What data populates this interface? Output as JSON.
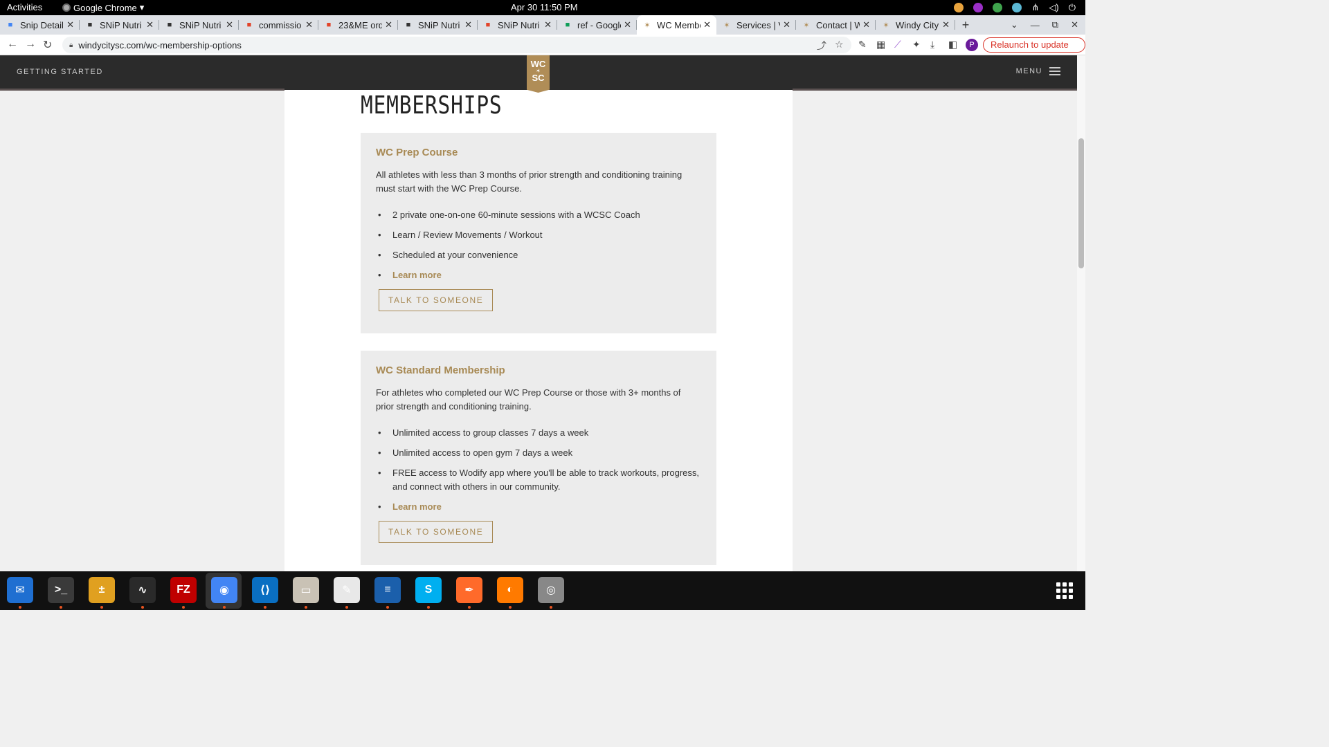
{
  "system_bar": {
    "activities": "Activities",
    "app_name": "Google Chrome",
    "clock": "Apr 30  11:50 PM"
  },
  "tabs": [
    {
      "title": "Snip Detail",
      "icon": "docs-icon",
      "color": "#4285f4",
      "active": false
    },
    {
      "title": "SNiP Nutri",
      "icon": "snip-icon",
      "color": "#333333",
      "active": false
    },
    {
      "title": "SNiP Nutri",
      "icon": "snip-icon",
      "color": "#333333",
      "active": false
    },
    {
      "title": "commissio",
      "icon": "gitlab-icon",
      "color": "#e24329",
      "active": false
    },
    {
      "title": "23&ME ord",
      "icon": "gitlab-icon",
      "color": "#e24329",
      "active": false
    },
    {
      "title": "SNiP Nutri",
      "icon": "snip-icon",
      "color": "#333333",
      "active": false
    },
    {
      "title": "SNiP Nutri",
      "icon": "snip-icon",
      "color": "#e24329",
      "active": false
    },
    {
      "title": "ref - Google",
      "icon": "sheets-icon",
      "color": "#0f9d58",
      "active": false
    },
    {
      "title": "WC Membe",
      "icon": "wcsc-icon",
      "color": "#b08d57",
      "active": true
    },
    {
      "title": "Services | V",
      "icon": "wcsc-icon",
      "color": "#b08d57",
      "active": false
    },
    {
      "title": "Contact | W",
      "icon": "wcsc-icon",
      "color": "#b08d57",
      "active": false
    },
    {
      "title": "Windy City",
      "icon": "wcsc-icon",
      "color": "#b08d57",
      "active": false
    }
  ],
  "browser": {
    "url": "windycitysc.com/wc-membership-options",
    "relaunch": "Relaunch to update",
    "profile_initial": "P"
  },
  "site": {
    "nav_left": "GETTING STARTED",
    "nav_right": "MENU",
    "logo_top": "WC",
    "logo_bottom": "SC",
    "page_title": "MEMBERSHIPS",
    "accent_color": "#a88a55"
  },
  "cards": [
    {
      "title": "WC Prep Course",
      "description": "All athletes with less than 3 months of prior strength and conditioning training must start with the WC Prep Course.",
      "bullets": [
        "2 private one-on-one 60-minute sessions with a WCSC Coach",
        "Learn / Review Movements / Workout",
        "Scheduled at your convenience"
      ],
      "link": "Learn more",
      "button": "TALK TO SOMEONE"
    },
    {
      "title": "WC Standard Membership",
      "description": "For athletes who completed our WC Prep Course or those with 3+ months of prior strength and conditioning training.",
      "bullets": [
        "Unlimited access to group classes 7 days a week",
        "Unlimited access to open gym 7 days a week",
        "FREE access to Wodify app where you'll be able to track workouts, progress, and connect with others in our community."
      ],
      "link": "Learn more",
      "button": "TALK TO SOMEONE"
    }
  ],
  "dock": [
    {
      "name": "thunderbird-icon",
      "color": "#1f6fd1",
      "glyph": "✉"
    },
    {
      "name": "terminal-icon",
      "color": "#3a3a3a",
      "glyph": ">_"
    },
    {
      "name": "calculator-icon",
      "color": "#e0a020",
      "glyph": "±"
    },
    {
      "name": "system-monitor-icon",
      "color": "#2a2a2a",
      "glyph": "∿"
    },
    {
      "name": "filezilla-icon",
      "color": "#bf0000",
      "glyph": "FZ"
    },
    {
      "name": "chrome-icon",
      "color": "#4285f4",
      "glyph": "◉"
    },
    {
      "name": "vscode-icon",
      "color": "#0a6fc2",
      "glyph": "⟨⟩"
    },
    {
      "name": "files-icon",
      "color": "#c9c2b5",
      "glyph": "▭"
    },
    {
      "name": "text-editor-icon",
      "color": "#e8e8e8",
      "glyph": "✎"
    },
    {
      "name": "libreoffice-writer-icon",
      "color": "#1b5fab",
      "glyph": "≡"
    },
    {
      "name": "skype-icon",
      "color": "#00aff0",
      "glyph": "S"
    },
    {
      "name": "inkscape-icon",
      "color": "#ff6a2a",
      "glyph": "✒"
    },
    {
      "name": "firefox-dev-icon",
      "color": "#ff7a00",
      "glyph": "◐"
    },
    {
      "name": "disks-icon",
      "color": "#888888",
      "glyph": "◎"
    }
  ]
}
